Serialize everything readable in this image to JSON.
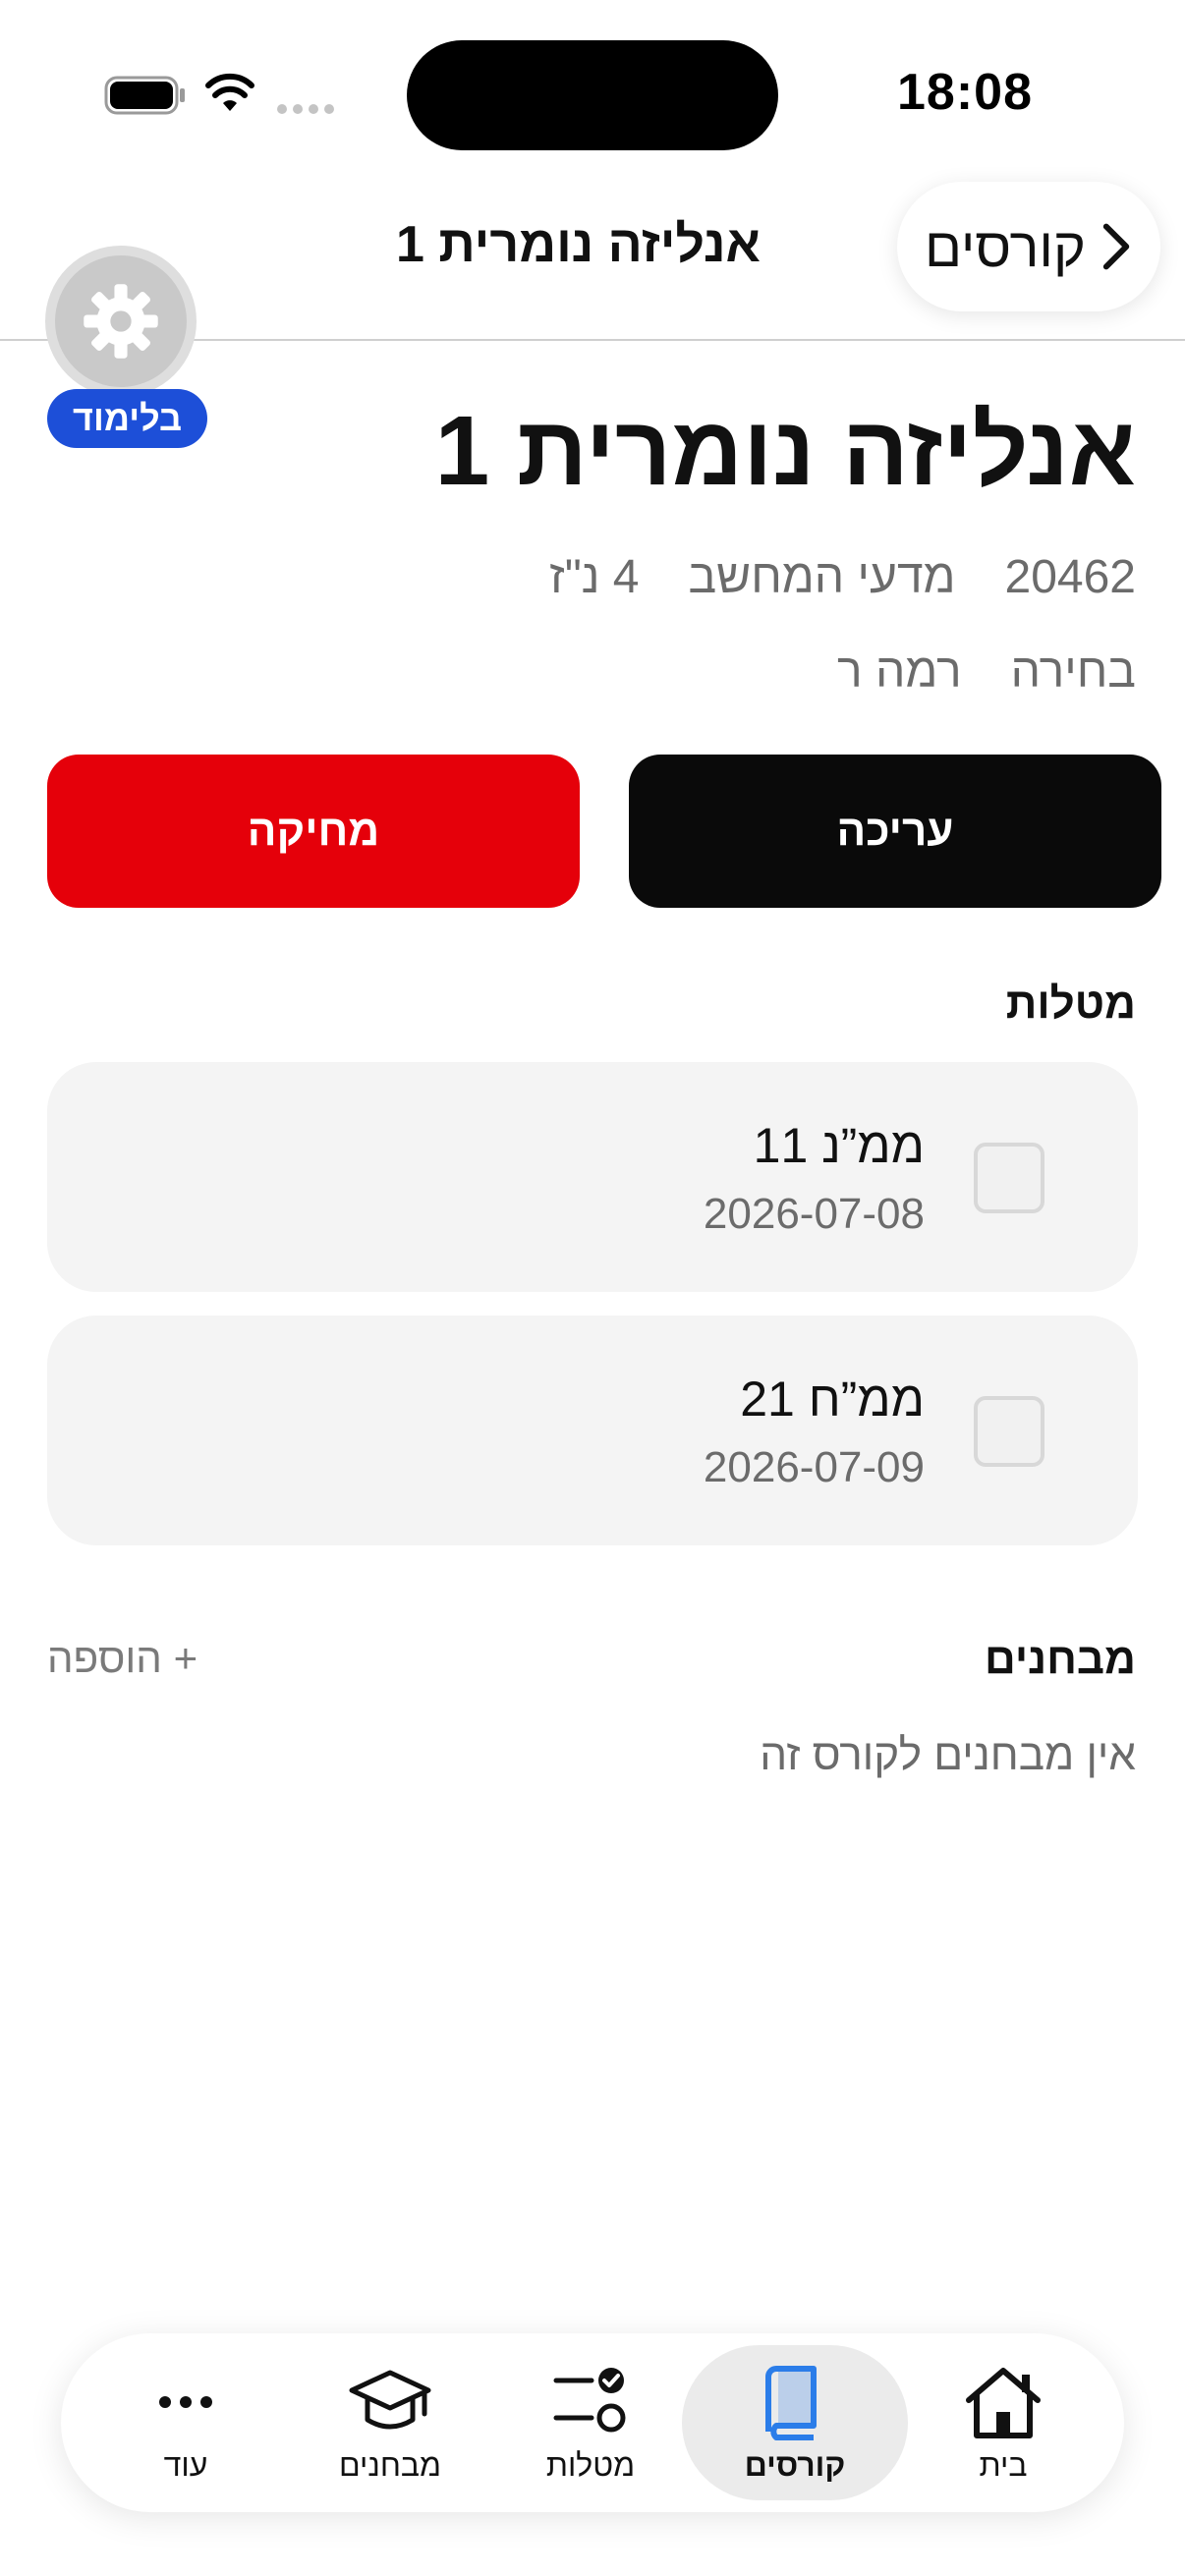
{
  "status_bar": {
    "time": "18:08"
  },
  "nav": {
    "back_label": "קורסים",
    "title": "אנליזה נומרית 1"
  },
  "badge": "בלימוד",
  "course": {
    "title": "אנליזה נומרית 1",
    "number": "20462",
    "department": "מדעי המחשב",
    "credits": "4 נ\"ז",
    "type": "בחירה",
    "level": "רמה ר"
  },
  "actions": {
    "edit_label": "עריכה",
    "delete_label": "מחיקה"
  },
  "tasks_section": {
    "title": "מטלות",
    "items": [
      {
        "name": "ממ”נ 11",
        "date": "2026-07-08",
        "done": false
      },
      {
        "name": "ממ”ח 21",
        "date": "2026-07-09",
        "done": false
      }
    ]
  },
  "exams_section": {
    "title": "מבחנים",
    "add_label": "+ הוספה",
    "empty_message": "אין מבחנים לקורס זה"
  },
  "tab_bar": {
    "items": [
      {
        "label": "בית",
        "icon": "home-icon",
        "active": false
      },
      {
        "label": "קורסים",
        "icon": "book-icon",
        "active": true
      },
      {
        "label": "מטלות",
        "icon": "tasks-icon",
        "active": false
      },
      {
        "label": "מבחנים",
        "icon": "graduation-cap-icon",
        "active": false
      },
      {
        "label": "עוד",
        "icon": "more-icon",
        "active": false
      }
    ]
  },
  "colors": {
    "accent_blue": "#1d4fd8",
    "delete_red": "#e5000a",
    "primary_black": "#0a0a0a",
    "active_tab_icon": "#2b7de9"
  }
}
